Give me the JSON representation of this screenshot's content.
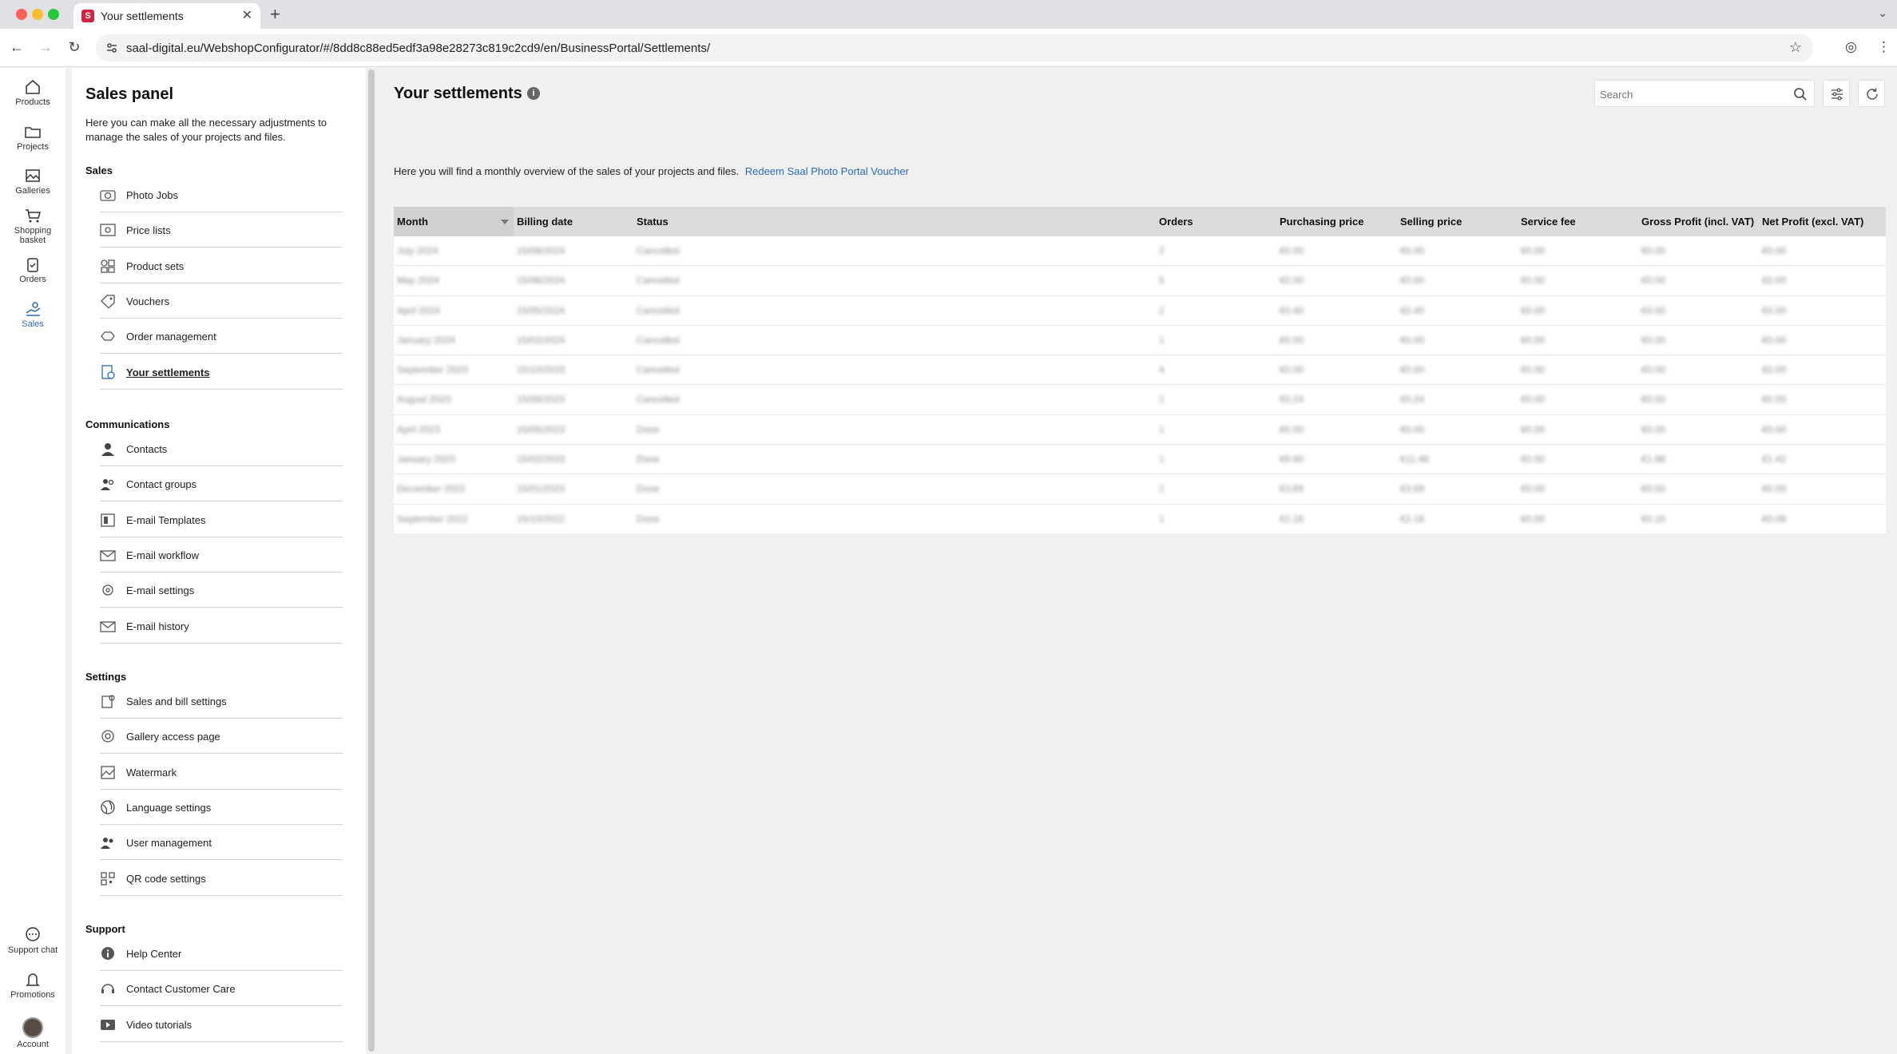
{
  "browser": {
    "tab_title": "Your settlements",
    "url": "saal-digital.eu/WebshopConfigurator/#/8dd8c88ed5edf3a98e28273c819c2cd9/en/BusinessPortal/Settlements/"
  },
  "rail": {
    "top": [
      {
        "label": "Products",
        "icon": "home-icon"
      },
      {
        "label": "Projects",
        "icon": "folder-icon"
      },
      {
        "label": "Galleries",
        "icon": "gallery-icon"
      },
      {
        "label": "Shopping basket",
        "icon": "cart-icon"
      },
      {
        "label": "Orders",
        "icon": "orders-icon"
      },
      {
        "label": "Sales",
        "icon": "sales-icon"
      }
    ],
    "bottom": [
      {
        "label": "Support chat",
        "icon": "chat-icon"
      },
      {
        "label": "Promotions",
        "icon": "promotions-icon"
      },
      {
        "label": "Account",
        "icon": "avatar"
      }
    ]
  },
  "panel": {
    "title": "Sales panel",
    "description": "Here you can make all the necessary adjustments to manage the sales of your projects and files.",
    "sections": [
      {
        "heading": "Sales",
        "items": [
          "Photo Jobs",
          "Price lists",
          "Product sets",
          "Vouchers",
          "Order management",
          "Your settlements"
        ]
      },
      {
        "heading": "Communications",
        "items": [
          "Contacts",
          "Contact groups",
          "E-mail Templates",
          "E-mail workflow",
          "E-mail settings",
          "E-mail history"
        ]
      },
      {
        "heading": "Settings",
        "items": [
          "Sales and bill settings",
          "Gallery access page",
          "Watermark",
          "Language settings",
          "User management",
          "QR code settings"
        ]
      },
      {
        "heading": "Support",
        "items": [
          "Help Center",
          "Contact Customer Care",
          "Video tutorials"
        ]
      }
    ]
  },
  "main": {
    "title": "Your settlements",
    "search_placeholder": "Search",
    "intro_text": "Here you will find a monthly overview of the sales of your projects and files.",
    "intro_link": "Redeem Saal Photo Portal Voucher"
  },
  "table": {
    "headers": [
      "Month",
      "Billing date",
      "Status",
      "Orders",
      "Purchasing price",
      "Selling price",
      "Service fee",
      "Gross Profit (incl. VAT)",
      "Net Profit (excl. VAT)"
    ],
    "rows": [
      [
        "July 2024",
        "15/08/2024",
        "Cancelled",
        "2",
        "€0.00",
        "€0.00",
        "€0.00",
        "€0.00",
        "€0.00"
      ],
      [
        "May 2024",
        "15/06/2024",
        "Cancelled",
        "5",
        "€0.00",
        "€0.00",
        "€0.00",
        "€0.00",
        "€0.00"
      ],
      [
        "April 2024",
        "15/05/2024",
        "Cancelled",
        "2",
        "€0.40",
        "€0.40",
        "€0.00",
        "€0.00",
        "€0.00"
      ],
      [
        "January 2024",
        "15/02/2024",
        "Cancelled",
        "1",
        "€0.00",
        "€0.00",
        "€0.00",
        "€0.00",
        "€0.00"
      ],
      [
        "September 2023",
        "15/10/2023",
        "Cancelled",
        "4",
        "€0.00",
        "€0.00",
        "€0.00",
        "€0.00",
        "€0.00"
      ],
      [
        "August 2023",
        "15/09/2023",
        "Cancelled",
        "1",
        "€0.24",
        "€0.24",
        "€0.00",
        "€0.00",
        "€0.00"
      ],
      [
        "April 2023",
        "15/05/2023",
        "Done",
        "1",
        "€0.00",
        "€0.00",
        "€0.00",
        "€0.00",
        "€0.00"
      ],
      [
        "January 2023",
        "15/02/2023",
        "Done",
        "1",
        "€9.60",
        "€11.48",
        "€0.00",
        "€1.88",
        "€1.42"
      ],
      [
        "December 2022",
        "15/01/2023",
        "Done",
        "1",
        "€3.69",
        "€3.69",
        "€0.00",
        "€0.00",
        "€0.00"
      ],
      [
        "September 2022",
        "15/10/2022",
        "Done",
        "1",
        "€2.18",
        "€2.18",
        "€0.00",
        "€0.10",
        "€0.08"
      ]
    ]
  }
}
